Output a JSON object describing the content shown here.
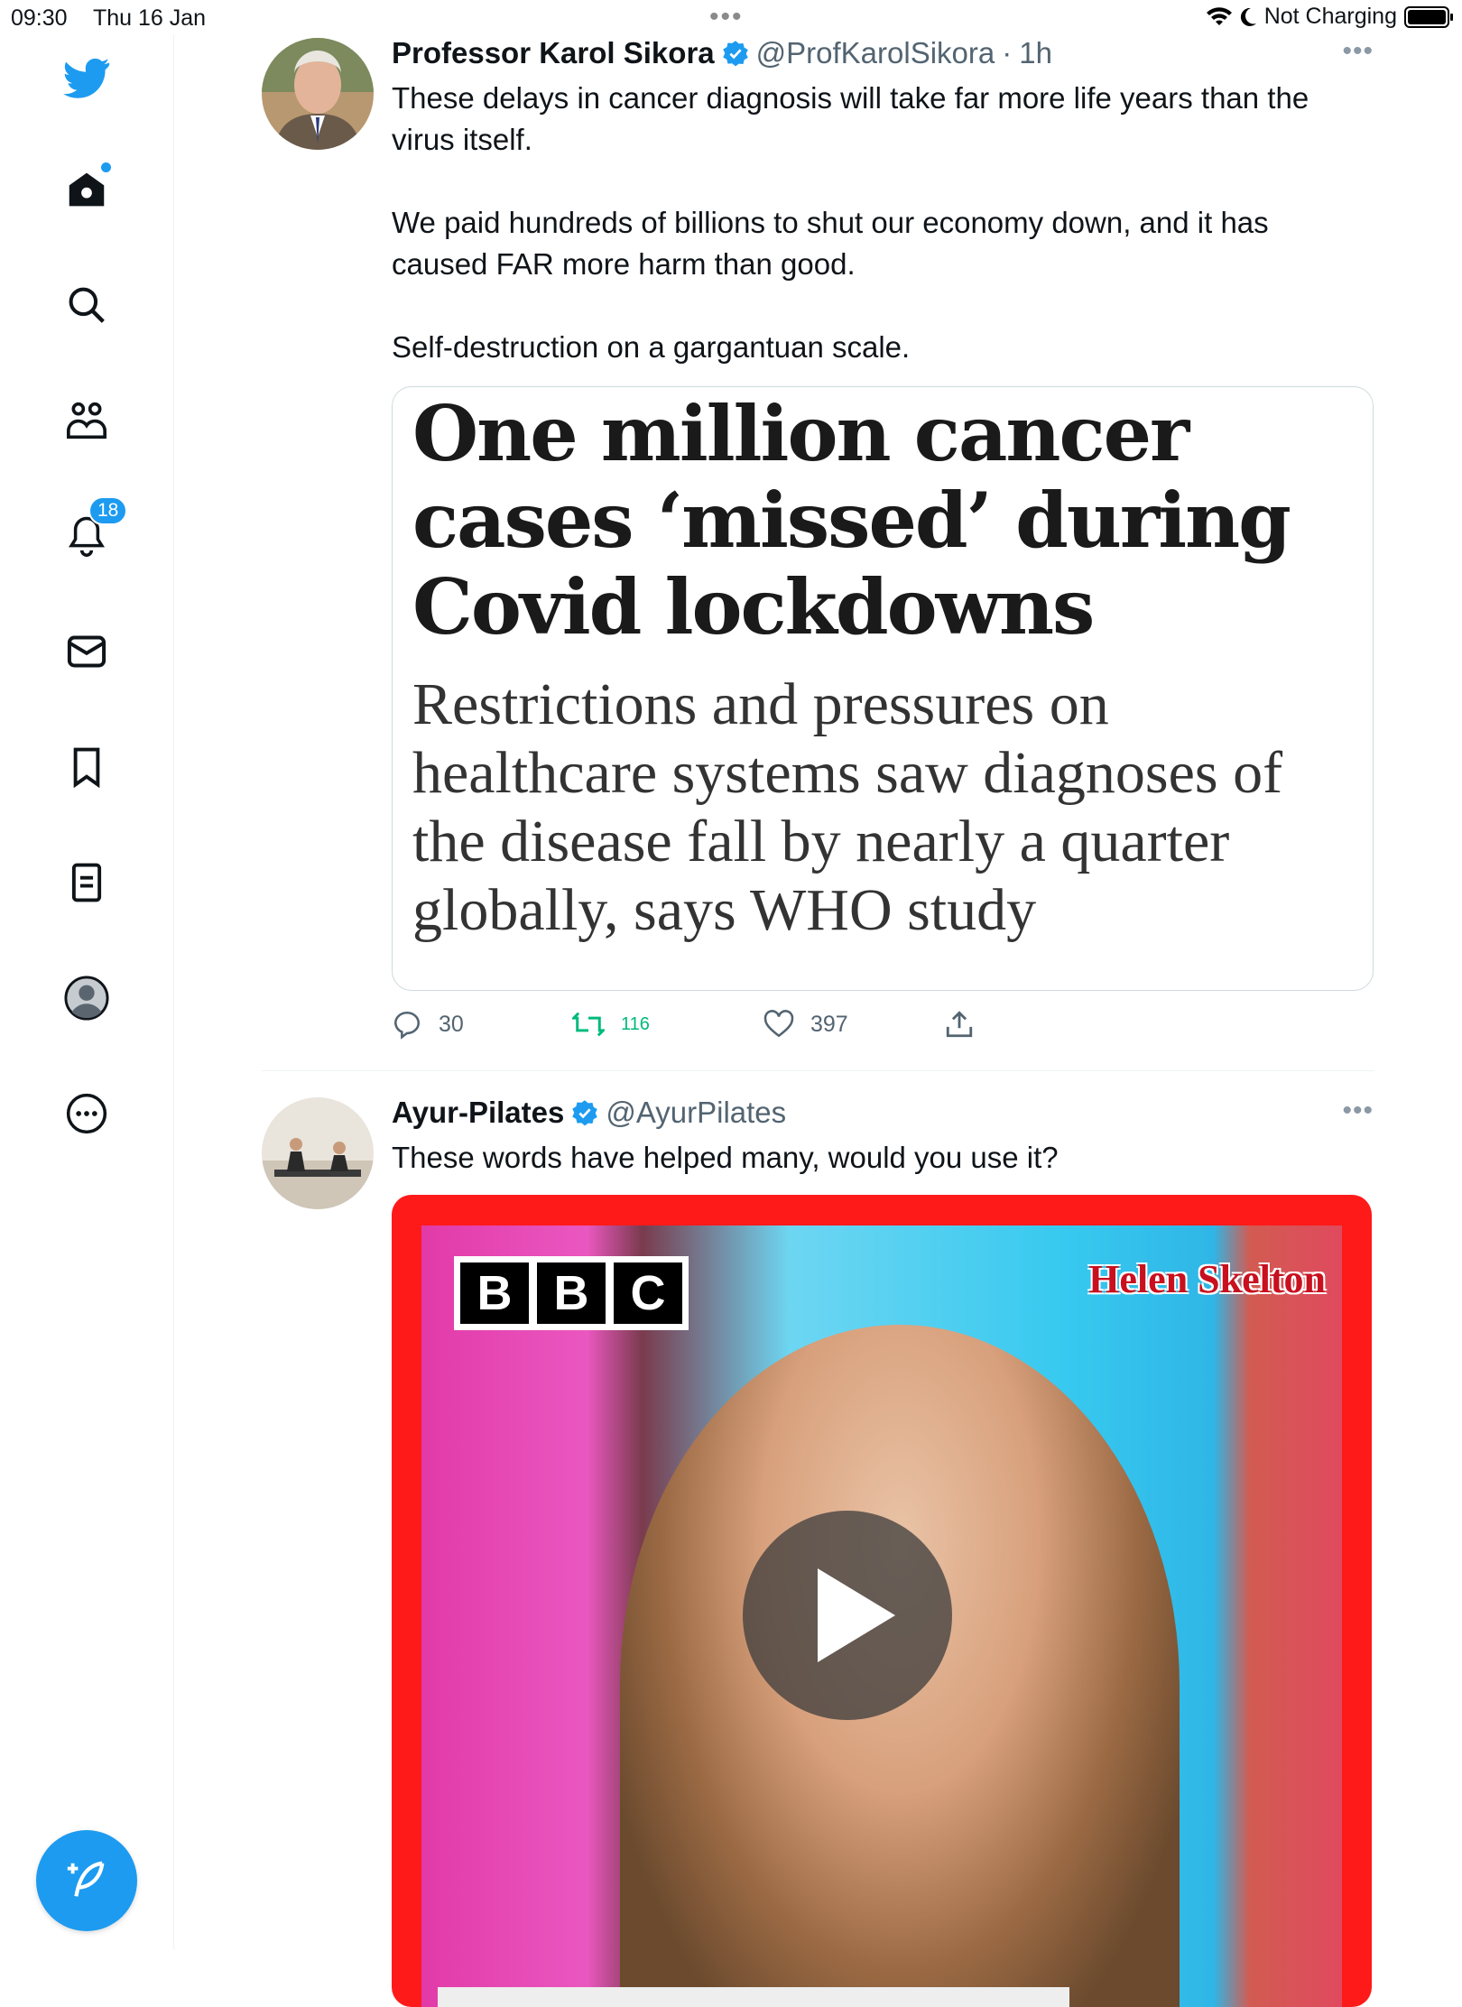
{
  "status_bar": {
    "time": "09:30",
    "date": "Thu 16 Jan",
    "charging": "Not Charging"
  },
  "sidebar": {
    "items": [
      {
        "name": "home",
        "icon": "home-icon"
      },
      {
        "name": "explore",
        "icon": "search-icon"
      },
      {
        "name": "communities",
        "icon": "communities-icon"
      },
      {
        "name": "notifications",
        "icon": "bell-icon",
        "badge": "18"
      },
      {
        "name": "messages",
        "icon": "mail-icon"
      },
      {
        "name": "bookmarks",
        "icon": "bookmark-icon"
      },
      {
        "name": "lists",
        "icon": "list-icon"
      },
      {
        "name": "profile",
        "icon": "profile-icon"
      },
      {
        "name": "more",
        "icon": "more-circle-icon"
      }
    ],
    "accent": "#1d9bf0"
  },
  "tweets": [
    {
      "name": "Professor Karol Sikora",
      "handle": "@ProfKarolSikora",
      "time": "1h",
      "text": [
        "These delays in cancer diagnosis will take far more life years than the virus itself.",
        "We paid hundreds of billions to shut our economy down, and it has caused FAR more harm than good.",
        "Self-destruction on a gargantuan scale."
      ],
      "card": {
        "headline": "One million cancer cases ‘missed’ during Covid lockdowns",
        "subhead": "Restrictions and pressures on healthcare systems saw diagnoses of the disease fall by nearly a quarter globally, says WHO study"
      },
      "replies": "30",
      "retweets": "116",
      "likes": "397"
    },
    {
      "name": "Ayur-Pilates",
      "handle": "@AyurPilates",
      "text": "These words have helped many, would you use it?",
      "video": {
        "logo_letters": [
          "B",
          "B",
          "C"
        ],
        "tag": "Helen Skelton"
      }
    }
  ]
}
